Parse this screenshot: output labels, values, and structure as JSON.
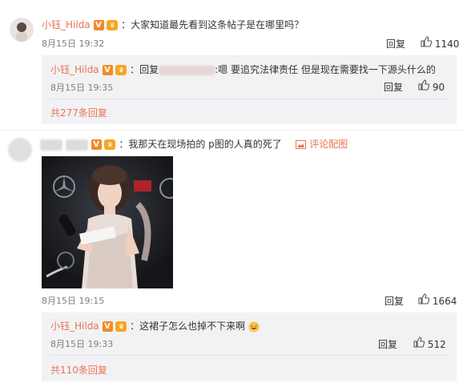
{
  "comments": [
    {
      "user": "小钰_Hilda",
      "text": "：大家知道最先看到这条帖子是在哪里吗？",
      "time": "8月15日 19:32",
      "reply_label": "回复",
      "likes": "1140",
      "sub": {
        "user": "小钰_Hilda",
        "prefix": "：回复",
        "text": ":嗯 要追究法律责任 但是现在需要找一下源头什么的",
        "time": "8月15日 19:35",
        "reply_label": "回复",
        "likes": "90"
      },
      "more": "共277条回复"
    },
    {
      "text": "：我那天在现场拍的 p图的人真的死了",
      "view_pic": "评论配图",
      "time": "8月15日 19:15",
      "reply_label": "回复",
      "likes": "1664",
      "sub": {
        "user": "小钰_Hilda",
        "text": "：这裙子怎么也掉不下来啊",
        "time": "8月15日 19:33",
        "reply_label": "回复",
        "likes": "512"
      },
      "more": "共110条回复"
    }
  ],
  "colors": {
    "accent": "#eb7350",
    "reply_bg": "#f2f2f5",
    "meta": "#808080"
  },
  "icons": [
    "thumbs-up-icon",
    "verified-v-icon",
    "vip-icon",
    "picture-icon",
    "avatar"
  ]
}
